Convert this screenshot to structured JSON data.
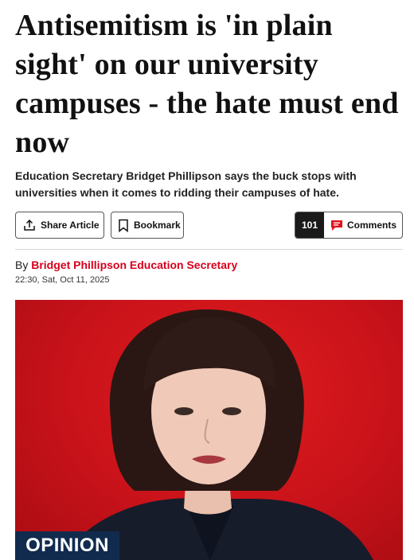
{
  "article": {
    "headline": "Antisemitism is 'in plain sight' on our university campuses - the hate must end now",
    "standfirst": "Education Secretary Bridget Phillipson says the buck stops with universities when it comes to ridding their campuses of hate.",
    "byline_prefix": "By ",
    "author": "Bridget Phillipson Education Secretary",
    "timestamp": "22:30, Sat, Oct 11, 2025",
    "section_badge": "OPINION"
  },
  "actions": {
    "share_label": "Share Article",
    "bookmark_label": "Bookmark",
    "comments_count": "101",
    "comments_label": "Comments"
  },
  "colors": {
    "accent_red": "#d6001c",
    "badge_navy": "#112b4e",
    "photo_background": "#c8121a"
  }
}
